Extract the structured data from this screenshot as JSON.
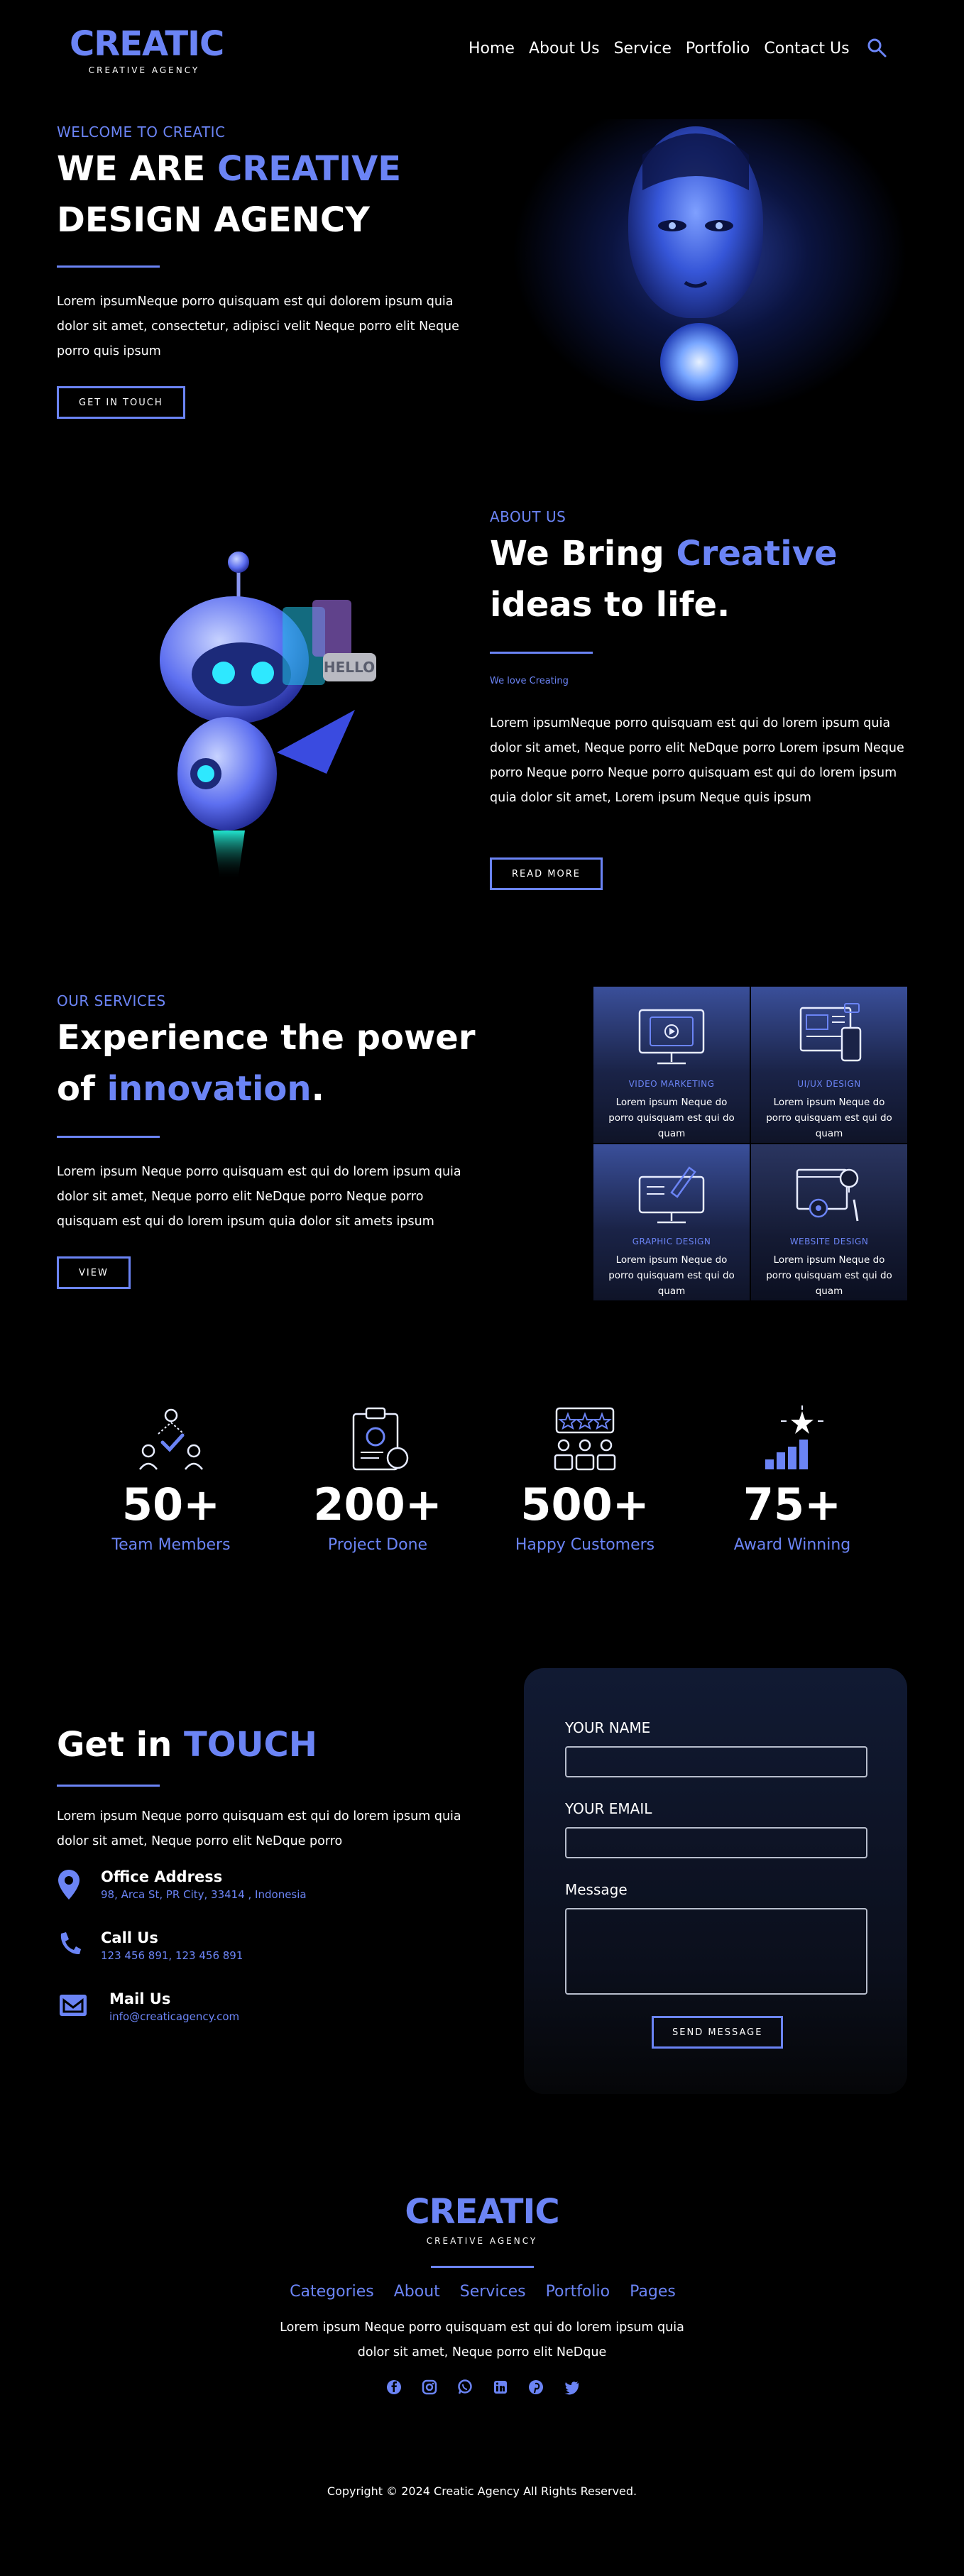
{
  "header": {
    "logo_title": "CREATIC",
    "logo_subtitle": "CREATIVE AGENCY",
    "nav": [
      "Home",
      "About Us",
      "Service",
      "Portfolio",
      "Contact Us"
    ],
    "search_icon": "search-icon"
  },
  "hero": {
    "eyebrow": "WELCOME TO CREATIC",
    "title_a": "WE ARE ",
    "title_accent": "CREATIVE",
    "title_b": "DESIGN AGENCY",
    "text": "Lorem ipsumNeque porro quisquam est qui dolorem ipsum quia dolor sit amet, consectetur, adipisci velit Neque porro elit Neque porro quis ipsum",
    "button": "GET IN TOUCH"
  },
  "about": {
    "eyebrow": "ABOUT US",
    "title_a": "We Bring ",
    "title_accent": "Creative",
    "title_b": "ideas to life.",
    "sub": "We love Creating",
    "text": "Lorem ipsumNeque porro quisquam est qui do lorem ipsum quia dolor sit amet, Neque porro elit NeDque porro Lorem ipsum Neque porro Neque porro Neque porro quisquam est qui do lorem ipsum quia dolor sit amet, Lorem ipsum Neque quis ipsum",
    "button": "READ MORE",
    "robot_sign": "HELLO"
  },
  "services": {
    "eyebrow": "OUR SERVICES",
    "title_a": "Experience the power",
    "title_b": "of ",
    "title_accent": "innovation",
    "title_end": ".",
    "text": "Lorem ipsum Neque porro quisquam est qui do lorem ipsum quia dolor sit amet, Neque porro elit NeDque porro Neque porro quisquam est qui do lorem ipsum quia dolor sit amets ipsum",
    "button": "VIEW",
    "cards": [
      {
        "title": "VIDEO MARKETING",
        "text": "Lorem ipsum Neque do porro quisquam est qui do quam",
        "icon": "video-marketing-icon"
      },
      {
        "title": "UI/UX DESIGN",
        "text": "Lorem ipsum Neque do porro quisquam est qui do quam",
        "icon": "ui-ux-design-icon"
      },
      {
        "title": "GRAPHIC DESIGN",
        "text": "Lorem ipsum Neque do porro quisquam est qui do quam",
        "icon": "graphic-design-icon"
      },
      {
        "title": "WEBSITE DESIGN",
        "text": "Lorem ipsum Neque do porro quisquam est qui do quam",
        "icon": "website-design-icon"
      }
    ]
  },
  "stats": [
    {
      "value": "50+",
      "label": "Team Members",
      "icon": "team-icon"
    },
    {
      "value": "200+",
      "label": "Project Done",
      "icon": "clipboard-icon"
    },
    {
      "value": "500+",
      "label": "Happy Customers",
      "icon": "customers-rating-icon"
    },
    {
      "value": "75+",
      "label": "Award Winning",
      "icon": "award-chart-icon"
    }
  ],
  "contact": {
    "title_a": "Get in ",
    "title_accent": "TOUCH",
    "text": "Lorem ipsum Neque porro quisquam est qui do lorem ipsum quia dolor sit amet, Neque porro elit NeDque porro",
    "items": [
      {
        "title": "Office Address",
        "text": "98, Arca St, PR City, 33414 , Indonesia",
        "icon": "location-pin-icon"
      },
      {
        "title": "Call Us",
        "text": "123 456 891, 123 456 891",
        "icon": "phone-icon"
      },
      {
        "title": "Mail Us",
        "text": "info@creaticagency.com",
        "icon": "mail-icon"
      }
    ],
    "form": {
      "name_label": "YOUR NAME",
      "email_label": "YOUR EMAIL",
      "message_label": "Message",
      "name_value": "",
      "email_value": "",
      "message_value": "",
      "button": "SEND MESSAGE"
    }
  },
  "footer": {
    "logo_title": "CREATIC",
    "logo_subtitle": "CREATIVE AGENCY",
    "nav": [
      "Categories",
      "About",
      "Services",
      "Portfolio",
      "Pages"
    ],
    "text": "Lorem ipsum Neque porro quisquam est qui do lorem ipsum quia dolor sit amet, Neque porro elit NeDque",
    "socials": [
      "facebook-icon",
      "instagram-icon",
      "whatsapp-icon",
      "linkedin-icon",
      "pinterest-icon",
      "twitter-icon"
    ],
    "copyright": "Copyright © 2024 Creatic Agency All Rights Reserved."
  },
  "colors": {
    "accent": "#6b84f5",
    "background": "#000000",
    "card": "#1a2347"
  }
}
